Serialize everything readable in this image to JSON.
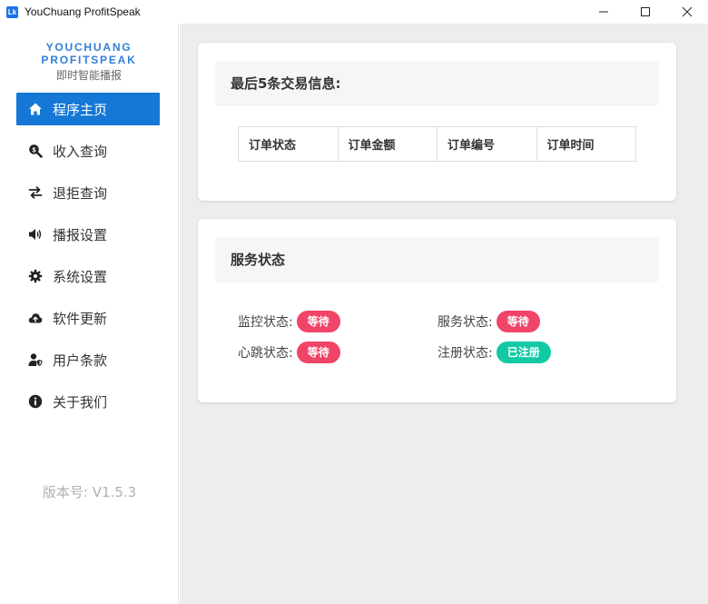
{
  "window": {
    "title": "YouChuang ProfitSpeak",
    "icon_text": "Lk"
  },
  "sidebar": {
    "brand_line1": "YOUCHUANG",
    "brand_line2": "PROFITSPEAK",
    "brand_sub": "即时智能播报",
    "items": [
      {
        "label": "程序主页",
        "icon": "home-icon",
        "active": true
      },
      {
        "label": "收入查询",
        "icon": "search-dollar-icon"
      },
      {
        "label": "退拒查询",
        "icon": "exchange-icon"
      },
      {
        "label": "播报设置",
        "icon": "volume-icon"
      },
      {
        "label": "系统设置",
        "icon": "gear-icon"
      },
      {
        "label": "软件更新",
        "icon": "cloud-upload-icon"
      },
      {
        "label": "用户条款",
        "icon": "user-shield-icon"
      },
      {
        "label": "关于我们",
        "icon": "info-icon"
      }
    ],
    "version": "版本号: V1.5.3"
  },
  "transactions": {
    "title": "最后5条交易信息:",
    "columns": [
      "订单状态",
      "订单金额",
      "订单编号",
      "订单时间"
    ]
  },
  "service": {
    "title": "服务状态",
    "rows": [
      [
        {
          "label": "监控状态:",
          "value": "等待",
          "color": "#f04468"
        },
        {
          "label": "服务状态:",
          "value": "等待",
          "color": "#f04468"
        }
      ],
      [
        {
          "label": "心跳状态:",
          "value": "等待",
          "color": "#f04468"
        },
        {
          "label": "注册状态:",
          "value": "已注册",
          "color": "#12c9a5"
        }
      ]
    ]
  },
  "colors": {
    "accent": "#1577d6",
    "brand": "#2f7fd9",
    "waiting": "#f04468",
    "registered": "#12c9a5"
  }
}
